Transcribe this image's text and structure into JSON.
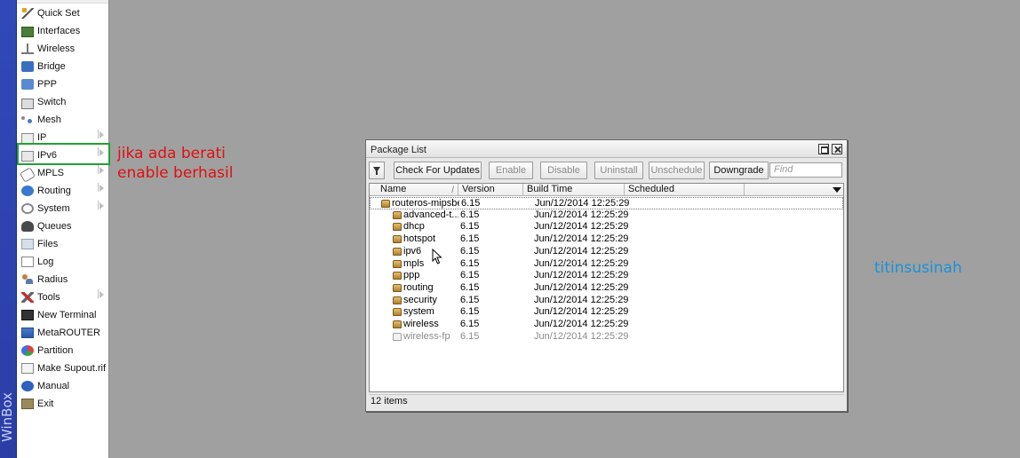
{
  "app": {
    "brand": "WinBox"
  },
  "menu": [
    {
      "label": "Quick Set",
      "icon": "wand-icon",
      "submenu": false
    },
    {
      "label": "Interfaces",
      "icon": "interfaces-icon",
      "submenu": false
    },
    {
      "label": "Wireless",
      "icon": "wireless-icon",
      "submenu": false
    },
    {
      "label": "Bridge",
      "icon": "bridge-icon",
      "submenu": false
    },
    {
      "label": "PPP",
      "icon": "ppp-icon",
      "submenu": false
    },
    {
      "label": "Switch",
      "icon": "switch-icon",
      "submenu": false
    },
    {
      "label": "Mesh",
      "icon": "mesh-icon",
      "submenu": false
    },
    {
      "label": "IP",
      "icon": "ip-icon",
      "submenu": true
    },
    {
      "label": "IPv6",
      "icon": "ipv6-icon",
      "submenu": true
    },
    {
      "label": "MPLS",
      "icon": "mpls-icon",
      "submenu": true
    },
    {
      "label": "Routing",
      "icon": "routing-icon",
      "submenu": true
    },
    {
      "label": "System",
      "icon": "system-icon",
      "submenu": true
    },
    {
      "label": "Queues",
      "icon": "queues-icon",
      "submenu": false
    },
    {
      "label": "Files",
      "icon": "files-icon",
      "submenu": false
    },
    {
      "label": "Log",
      "icon": "log-icon",
      "submenu": false
    },
    {
      "label": "Radius",
      "icon": "radius-icon",
      "submenu": false
    },
    {
      "label": "Tools",
      "icon": "tools-icon",
      "submenu": true
    },
    {
      "label": "New Terminal",
      "icon": "terminal-icon",
      "submenu": false
    },
    {
      "label": "MetaROUTER",
      "icon": "metarouter-icon",
      "submenu": false
    },
    {
      "label": "Partition",
      "icon": "partition-icon",
      "submenu": false
    },
    {
      "label": "Make Supout.rif",
      "icon": "supout-icon",
      "submenu": false
    },
    {
      "label": "Manual",
      "icon": "manual-icon",
      "submenu": false
    },
    {
      "label": "Exit",
      "icon": "exit-icon",
      "submenu": false
    }
  ],
  "annotation": {
    "line1": "jika ada berati",
    "line2": "enable berhasil",
    "color": "#e01010",
    "highlight_color": "#22a032"
  },
  "watermark": "titinsusinah",
  "package_window": {
    "title": "Package List",
    "toolbar": {
      "check_updates": "Check For Updates",
      "enable": "Enable",
      "disable": "Disable",
      "uninstall": "Uninstall",
      "unschedule": "Unschedule",
      "downgrade": "Downgrade",
      "find_placeholder": "Find"
    },
    "columns": {
      "name": "Name",
      "version": "Version",
      "build_time": "Build Time",
      "scheduled": "Scheduled"
    },
    "rows": [
      {
        "name": "routeros-mipsbe",
        "version": "6.15",
        "build_time": "Jun/12/2014 12:25:29",
        "scheduled": "",
        "level": 0,
        "disabled": false
      },
      {
        "name": "advanced-t...",
        "version": "6.15",
        "build_time": "Jun/12/2014 12:25:29",
        "scheduled": "",
        "level": 1,
        "disabled": false
      },
      {
        "name": "dhcp",
        "version": "6.15",
        "build_time": "Jun/12/2014 12:25:29",
        "scheduled": "",
        "level": 1,
        "disabled": false
      },
      {
        "name": "hotspot",
        "version": "6.15",
        "build_time": "Jun/12/2014 12:25:29",
        "scheduled": "",
        "level": 1,
        "disabled": false
      },
      {
        "name": "ipv6",
        "version": "6.15",
        "build_time": "Jun/12/2014 12:25:29",
        "scheduled": "",
        "level": 1,
        "disabled": false
      },
      {
        "name": "mpls",
        "version": "6.15",
        "build_time": "Jun/12/2014 12:25:29",
        "scheduled": "",
        "level": 1,
        "disabled": false
      },
      {
        "name": "ppp",
        "version": "6.15",
        "build_time": "Jun/12/2014 12:25:29",
        "scheduled": "",
        "level": 1,
        "disabled": false
      },
      {
        "name": "routing",
        "version": "6.15",
        "build_time": "Jun/12/2014 12:25:29",
        "scheduled": "",
        "level": 1,
        "disabled": false
      },
      {
        "name": "security",
        "version": "6.15",
        "build_time": "Jun/12/2014 12:25:29",
        "scheduled": "",
        "level": 1,
        "disabled": false
      },
      {
        "name": "system",
        "version": "6.15",
        "build_time": "Jun/12/2014 12:25:29",
        "scheduled": "",
        "level": 1,
        "disabled": false
      },
      {
        "name": "wireless",
        "version": "6.15",
        "build_time": "Jun/12/2014 12:25:29",
        "scheduled": "",
        "level": 1,
        "disabled": false
      },
      {
        "name": "wireless-fp",
        "version": "6.15",
        "build_time": "Jun/12/2014 12:25:29",
        "scheduled": "",
        "level": 1,
        "disabled": true
      }
    ],
    "status": "12 items"
  }
}
